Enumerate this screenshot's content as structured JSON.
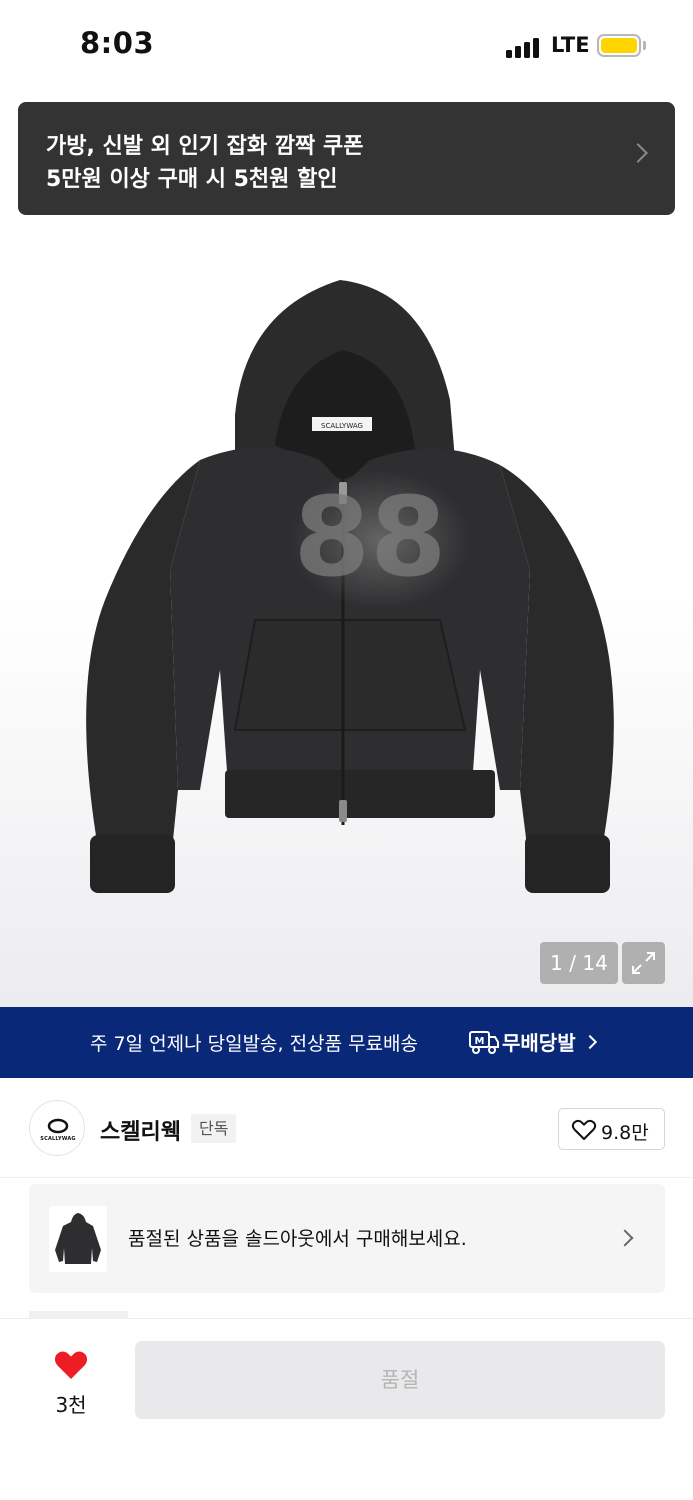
{
  "status_bar": {
    "time": "8:03",
    "network": "LTE",
    "battery_color": "#ffd400"
  },
  "coupon_banner": {
    "line1": "가방, 신발 외 인기 잡화 깜짝 쿠폰",
    "line2": "5만원 이상 구매 시 5천원 할인",
    "icon": "chevron-right-icon"
  },
  "gallery": {
    "counter": "1 / 14",
    "expand_icon": "expand-icon",
    "product_image": "black-zip-up-hoodie",
    "tag_text": "SCALLYWAG"
  },
  "delivery": {
    "text": "주 7일 언제나 당일발송, 전상품 무료배송",
    "badge": "무배당발",
    "badge_icon": "truck-icon",
    "background": "#0a2878"
  },
  "brand": {
    "name": "스켈리웩",
    "badge": "단독",
    "logo_text": "SCALLYWAG",
    "likes": "9.8만",
    "like_icon": "heart-outline-icon"
  },
  "soldout_banner": {
    "text": "품절된 상품을 솔드아웃에서 구매해보세요.",
    "icon": "chevron-right-icon"
  },
  "bottom_bar": {
    "wish_count": "3천",
    "wish_icon": "heart-filled-icon",
    "wish_color": "#ee1c25",
    "button_label": "품절"
  }
}
